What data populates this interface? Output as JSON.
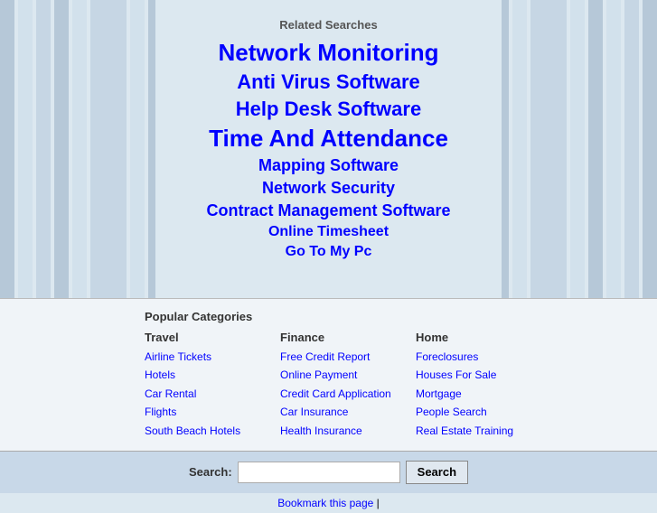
{
  "page": {
    "title": "Related Searches"
  },
  "related_searches": {
    "title": "Related Searches",
    "links": [
      {
        "label": "Network Monitoring",
        "size": "xl"
      },
      {
        "label": "Anti Virus Software",
        "size": "lg"
      },
      {
        "label": "Help Desk Software",
        "size": "lg"
      },
      {
        "label": "Time And Attendance",
        "size": "xl"
      },
      {
        "label": "Mapping Software",
        "size": "md"
      },
      {
        "label": "Network Security",
        "size": "md"
      },
      {
        "label": "Contract Management Software",
        "size": "md"
      },
      {
        "label": "Online Timesheet",
        "size": "sm"
      },
      {
        "label": "Go To My Pc",
        "size": "sm"
      }
    ]
  },
  "popular_categories": {
    "title": "Popular Categories",
    "columns": [
      {
        "header": "Travel",
        "links": [
          "Airline Tickets",
          "Hotels",
          "Car Rental",
          "Flights",
          "South Beach Hotels"
        ]
      },
      {
        "header": "Finance",
        "links": [
          "Free Credit Report",
          "Online Payment",
          "Credit Card Application",
          "Car Insurance",
          "Health Insurance"
        ]
      },
      {
        "header": "Home",
        "links": [
          "Foreclosures",
          "Houses For Sale",
          "Mortgage",
          "People Search",
          "Real Estate Training"
        ]
      }
    ]
  },
  "search_bar": {
    "label": "Search:",
    "button_label": "Search",
    "placeholder": ""
  },
  "bookmark": {
    "label": "Bookmark this page"
  }
}
